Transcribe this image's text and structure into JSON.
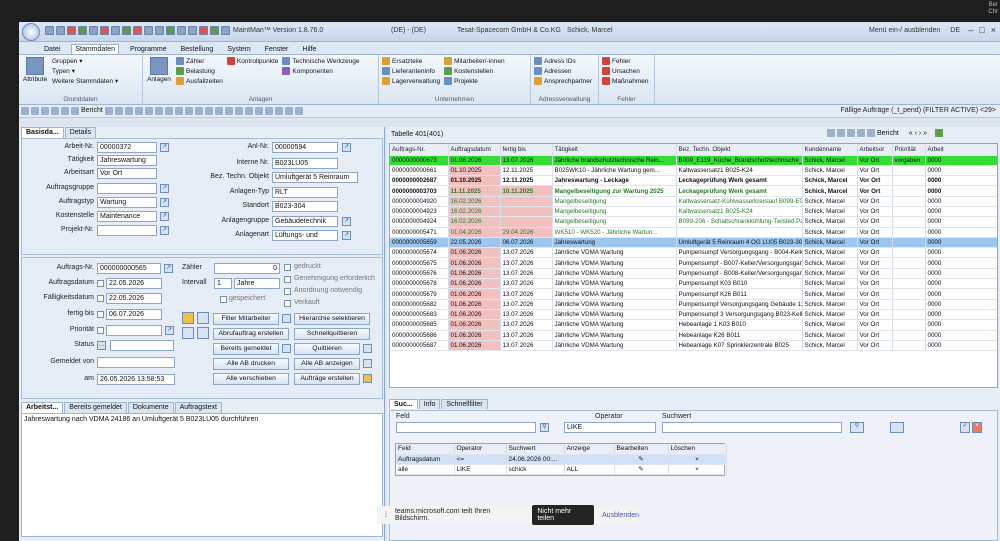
{
  "corner": {
    "line1": "Ber",
    "line2": "Chr"
  },
  "titlebar": {
    "app_title": "MaintMan™ Version 1.8.76.0",
    "env": "(DE) - (DE)",
    "company": "Tesat-Spacecom GmbH & Co.KG",
    "user": "Schick, Marcel",
    "menu_toggle": "Menü ein-/ ausblenden",
    "lang": "DE"
  },
  "menu": [
    "Datei",
    "Stammdaten",
    "Programme",
    "Bestellung",
    "System",
    "Fenster",
    "Hilfe"
  ],
  "ribbon": {
    "grunddaten": {
      "label": "Grunddaten",
      "big": "Attribute",
      "items": [
        "Gruppen",
        "Typen",
        "Weitere Stammdaten"
      ]
    },
    "anlagen": {
      "label": "Anlagen",
      "big": "Anlagen",
      "items": [
        "Zähler",
        "Belastung",
        "Ausfallzeiten",
        "Kontrollpunkte",
        "Technische Werkzeuge",
        "Komponenten"
      ]
    },
    "unternehmen": {
      "label": "Unternehmen",
      "items": [
        "Ersatzteile",
        "Lieferanteninfo",
        "Lagerverwaltung",
        "Mitarbeiter/-innen",
        "Kostenstellen",
        "Projekte"
      ]
    },
    "adress": {
      "label": "Adressverwaltung",
      "items": [
        "Adress IDs",
        "Adressen",
        "Ansprechpartner"
      ]
    },
    "fehler": {
      "label": "Fehler",
      "items": [
        "Fehler",
        "Ursachen",
        "Maßnahmen"
      ]
    }
  },
  "toolbar": {
    "bericht": "Bericht",
    "right_text": "Fällige Aufträge (_t_pend) (FILTER ACTIVE) <29>"
  },
  "left": {
    "tabs": [
      "Basisda...",
      "Details"
    ],
    "labels": {
      "arbeit_nr": "Arbeit-Nr.",
      "taetigkeit": "Tätigkeit",
      "arbeitsart": "Arbeitsart",
      "auftragsgruppe": "Auftragsgruppe",
      "auftragstyp": "Auftragstyp",
      "kostenstelle": "Kostenstelle",
      "projekt_nr": "Projekt-Nr.",
      "anl_nr": "Anl-Nr.",
      "interne_nr": "Interne Nr.",
      "bez_techn": "Bez. Techn. Objekt",
      "anlagen_typ": "Anlagen-Typ",
      "standort": "Standort",
      "anlagengruppe": "Anlagengruppe",
      "anlagenart": "Anlagenart",
      "auftrags_nr": "Auftrags-Nr.",
      "auftragsdatum": "Auftragsdatum",
      "faelligkeitsdatum": "Fälligkeitsdatum",
      "fertig_bis": "fertig bis",
      "prioritaet": "Priorität",
      "status": "Status",
      "gemeldet_von": "Gemeldet von",
      "am": "am",
      "zaehler": "Zähler",
      "intervall": "Intervall"
    },
    "values": {
      "arbeit_nr": "00000372",
      "taetigkeit": "Jahreswartung",
      "arbeitsart": "Vor Ort",
      "auftragstyp": "Wartung",
      "kostenstelle": "Maintenance",
      "anl_nr": "00000594",
      "interne_nr": "B023LU05",
      "bez_techn": "Umluftgerät 5 Reinraum",
      "anlagen_typ": "RLT",
      "standort": "B023-304",
      "anlagengruppe": "Gebäudetechnik",
      "anlagenart": "Lüftungs- und",
      "auftrags_nr": "000000000565",
      "auftragsdatum": "22.05.2026",
      "faelligkeitsdatum": "22.05.2026",
      "fertig_bis": "06.07.2026",
      "am": "26.05.2026 13:58:53",
      "zaehler": "0",
      "intervall_num": "1",
      "intervall_unit": "Jahre"
    },
    "checks": [
      "gedruckt",
      "Genehmigung erforderlich",
      "Anordnung notwendig",
      "Verkauft",
      "gespeichert"
    ],
    "buttons": [
      "Filter Mitarbeiter",
      "Hierarchie selektieren",
      "Abrufauftrag erstellen",
      "Schnellquittieren",
      "Bereits gemeldet",
      "Quittieren",
      "Alle AB drucken",
      "Alle AB anzeigen",
      "Alle verschieben",
      "Aufträge erstellen"
    ],
    "bottom_tabs": [
      "Arbeitst...",
      "Bereits gemeldet",
      "Dokumente",
      "Auftragstext"
    ],
    "text": "Jahreswartung nach VDMA 24186 an Umluftgerät 5 B023LU05 durchführen"
  },
  "grid": {
    "title": "Tabelle 401(401)",
    "bericht": "Bericht",
    "columns": [
      "Auftrags-Nr.",
      "Auftragsdatum",
      "fertig bis",
      "Tätigkeit",
      "Bez. Techn. Objekt",
      "Kundenname",
      "Arbeitsor",
      "Priorität",
      "Arbeit"
    ],
    "rows": [
      {
        "style": "green",
        "cells": [
          "0000000000673",
          "01.06.2026",
          "13.07.2026",
          "Jährliche brandschutztechnische Rein...",
          "B009_E119_Küche_Brandschutztechnische_Reinigung",
          "Schick, Marcel",
          "Vor Ort",
          "vorgaben",
          "0000"
        ]
      },
      {
        "style": "",
        "cells": [
          "0000000000661",
          "01.10.2025",
          "12.11.2025",
          "B025WK10 - Jährliche Wartung gem...",
          "Kaltwassersatz1 B025-K24",
          "Schick, Marcel",
          "Vor Ort",
          "",
          "0000"
        ]
      },
      {
        "style": "bold",
        "cells": [
          "0000000002687",
          "01.10.2025",
          "12.11.2025",
          "Jahreswartung - Leckage",
          "Leckageprüfung Werk gesamt",
          "Schick, Marcel",
          "Vor Ort",
          "",
          "0000"
        ]
      },
      {
        "style": "bolddark",
        "cells": [
          "0000000003703",
          "11.11.2025",
          "10.11.2025",
          "Mangelbeseitigung zur Wartung 2025",
          "Leckageprüfung Werk gesamt",
          "Schick, Marcel",
          "Vor Ort",
          "",
          "0000"
        ]
      },
      {
        "style": "dark",
        "cells": [
          "0000000004920",
          "16.02.2026",
          "",
          "Mangelbeseitigung",
          "Kaltwassersatz-Kühlwasserkreislauf B099-E000B09...",
          "Schick, Marcel",
          "Vor Ort",
          "",
          "0000"
        ]
      },
      {
        "style": "dark",
        "cells": [
          "0000000004923",
          "16.02.2026",
          "",
          "Mangelbeseitigung",
          "Kaltwassersatz1 B025-K24",
          "Schick, Marcel",
          "Vor Ort",
          "",
          "0000"
        ]
      },
      {
        "style": "dark",
        "cells": [
          "0000000004924",
          "16.02.2026",
          "",
          "Mangelbeseitigung",
          "B099-206 - Schaltschrankkühlung-Twisted Pair",
          "Schick, Marcel",
          "Vor Ort",
          "",
          "0000"
        ]
      },
      {
        "style": "dark",
        "cells": [
          "0000000005471",
          "01.04.2026",
          "29.04.2026",
          "WK510 - WK520 - Jährliche Wartun...",
          "",
          "Schick, Marcel",
          "Vor Ort",
          "",
          "0000"
        ]
      },
      {
        "style": "sel",
        "cells": [
          "0000000005659",
          "22.05.2026",
          "06.07.2026",
          "Jahreswartung",
          "Umluftgerät 5 Reinraum 4 OG LU05   B023-304",
          "Schick, Marcel",
          "Vor Ort",
          "",
          "0000"
        ]
      },
      {
        "style": "",
        "cells": [
          "0000000005674",
          "01.06.2026",
          "13.07.2026",
          "Jährliche VDMA Wartung",
          "Pumpensumpf Versorgungsgang - B004-Keller/Versor...",
          "Schick, Marcel",
          "Vor Ort",
          "",
          "0000"
        ]
      },
      {
        "style": "",
        "cells": [
          "0000000005675",
          "01.06.2026",
          "13.07.2026",
          "Jährliche VDMA Wartung",
          "Pumpensumpf - B007-Keller/Versorgungsgang",
          "Schick, Marcel",
          "Vor Ort",
          "",
          "0000"
        ]
      },
      {
        "style": "",
        "cells": [
          "0000000005676",
          "01.06.2026",
          "13.07.2026",
          "Jährliche VDMA Wartung",
          "Pumpensumpf - B008-Keller/Versorgungsgang",
          "Schick, Marcel",
          "Vor Ort",
          "",
          "0000"
        ]
      },
      {
        "style": "",
        "cells": [
          "0000000005678",
          "01.06.2026",
          "13.07.2026",
          "Jährliche VDMA Wartung",
          "Pumpensumpf K03 B010",
          "Schick, Marcel",
          "Vor Ort",
          "",
          "0000"
        ]
      },
      {
        "style": "",
        "cells": [
          "0000000005679",
          "01.06.2026",
          "13.07.2026",
          "Jährliche VDMA Wartung",
          "Pumpensumpf K26 B011",
          "Schick, Marcel",
          "Vor Ort",
          "",
          "0000"
        ]
      },
      {
        "style": "",
        "cells": [
          "0000000005682",
          "01.06.2026",
          "13.07.2026",
          "Jährliche VDMA Wartung",
          "Pumpensumpf Versorgungsgang Gebäude 11",
          "Schick, Marcel",
          "Vor Ort",
          "",
          "0000"
        ]
      },
      {
        "style": "",
        "cells": [
          "0000000005683",
          "01.06.2026",
          "13.07.2026",
          "Jährliche VDMA Wartung",
          "Pumpensumpf 3 Versorgungsgang B023-Keller",
          "Schick, Marcel",
          "Vor Ort",
          "",
          "0000"
        ]
      },
      {
        "style": "",
        "cells": [
          "0000000005685",
          "01.06.2026",
          "13.07.2026",
          "Jährliche VDMA Wartung",
          "Hebeanlage 1 K03 B010",
          "Schick, Marcel",
          "Vor Ort",
          "",
          "0000"
        ]
      },
      {
        "style": "",
        "cells": [
          "0000000005686",
          "01.06.2026",
          "13.07.2026",
          "Jährliche VDMA Wartung",
          "Hebeanlage K26 B011",
          "Schick, Marcel",
          "Vor Ort",
          "",
          "0000"
        ]
      },
      {
        "style": "",
        "cells": [
          "0000000005687",
          "01.06.2026",
          "13.07.2026",
          "Jährliche VDMA Wartung",
          "Hebeanlage K07 Sprinklerzentrale B025",
          "Schick, Marcel",
          "Vor Ort",
          "",
          "0000"
        ]
      }
    ]
  },
  "search": {
    "tabs": [
      "Suc...",
      "Info",
      "Schnellfilter"
    ],
    "feld_label": "Feld",
    "operator_label": "Operator",
    "operator_value": "LIKE",
    "suchwert_label": "Suchwert",
    "columns": [
      "Feld",
      "Operator",
      "Suchwert",
      "Anzeige",
      "Bearbeiten",
      "Löschen"
    ],
    "rows": [
      {
        "cells": [
          "Auftragsdatum",
          "<=",
          "24.06.2026 00:...",
          "",
          "",
          "×"
        ]
      },
      {
        "cells": [
          "alle",
          "LIKE",
          "schick",
          "ALL",
          "",
          "×"
        ]
      }
    ]
  },
  "share": {
    "text": "teams.microsoft.com teilt Ihren Bildschirm.",
    "stop": "Nicht mehr teilen",
    "hide": "Ausblenden"
  }
}
